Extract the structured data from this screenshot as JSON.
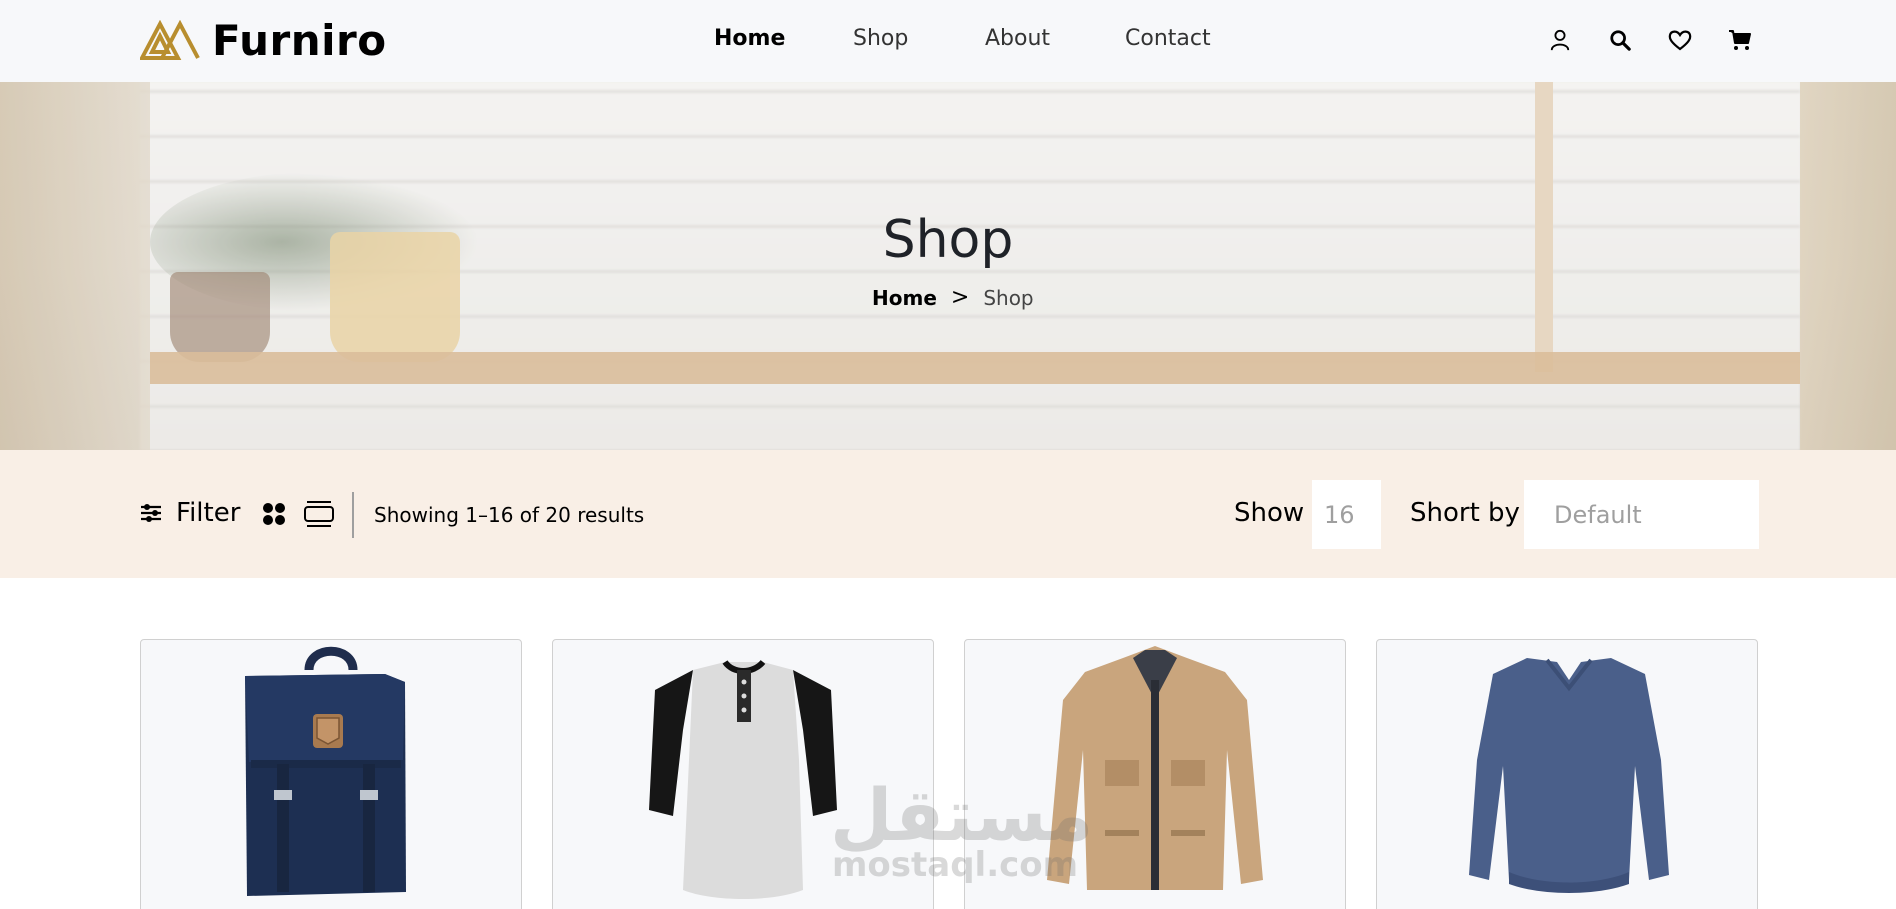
{
  "header": {
    "brand": "Furniro",
    "brand_color": "#b88e2f",
    "nav": [
      {
        "label": "Home",
        "active": true
      },
      {
        "label": "Shop",
        "active": false
      },
      {
        "label": "About",
        "active": false
      },
      {
        "label": "Contact",
        "active": false
      }
    ],
    "icons": [
      "user-icon",
      "search-icon",
      "heart-icon",
      "cart-icon"
    ]
  },
  "hero": {
    "title": "Shop",
    "breadcrumb": {
      "home": "Home",
      "separator": ">",
      "current": "Shop"
    }
  },
  "filterbar": {
    "filter_label": "Filter",
    "results_text": "Showing 1–16 of 20 results",
    "show_label": "Show",
    "show_value": "16",
    "sort_label": "Short by",
    "sort_value": "Default",
    "background": "#f9f1e7"
  },
  "products": [
    {
      "image": "backpack"
    },
    {
      "image": "henley-shirt"
    },
    {
      "image": "jacket"
    },
    {
      "image": "sweater"
    }
  ],
  "watermark": {
    "arabic": "مستقل",
    "latin": "mostaql.com"
  }
}
